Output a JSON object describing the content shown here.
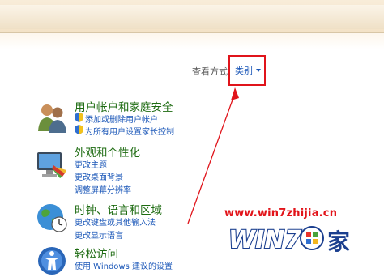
{
  "view": {
    "view_by_label": "查看方式:",
    "category_label": "类别"
  },
  "sections": [
    {
      "title": "用户帐户和家庭安全",
      "links": [
        "添加或删除用户帐户",
        "为所有用户设置家长控制"
      ]
    },
    {
      "title": "外观和个性化",
      "links": [
        "更改主题",
        "更改桌面背景",
        "调整屏幕分辨率"
      ]
    },
    {
      "title": "时钟、语言和区域",
      "links": [
        "更改键盘或其他输入法",
        "更改显示语言"
      ]
    },
    {
      "title": "轻松访问",
      "links": [
        "使用 Windows 建议的设置"
      ]
    }
  ],
  "watermark": {
    "url": "www.win7zhijia.cn",
    "logo_text": "WIN7",
    "logo_suffix": "家"
  },
  "colors": {
    "highlight_red": "#e0141b",
    "link_blue": "#1b57b8",
    "title_green": "#1d6b11"
  }
}
